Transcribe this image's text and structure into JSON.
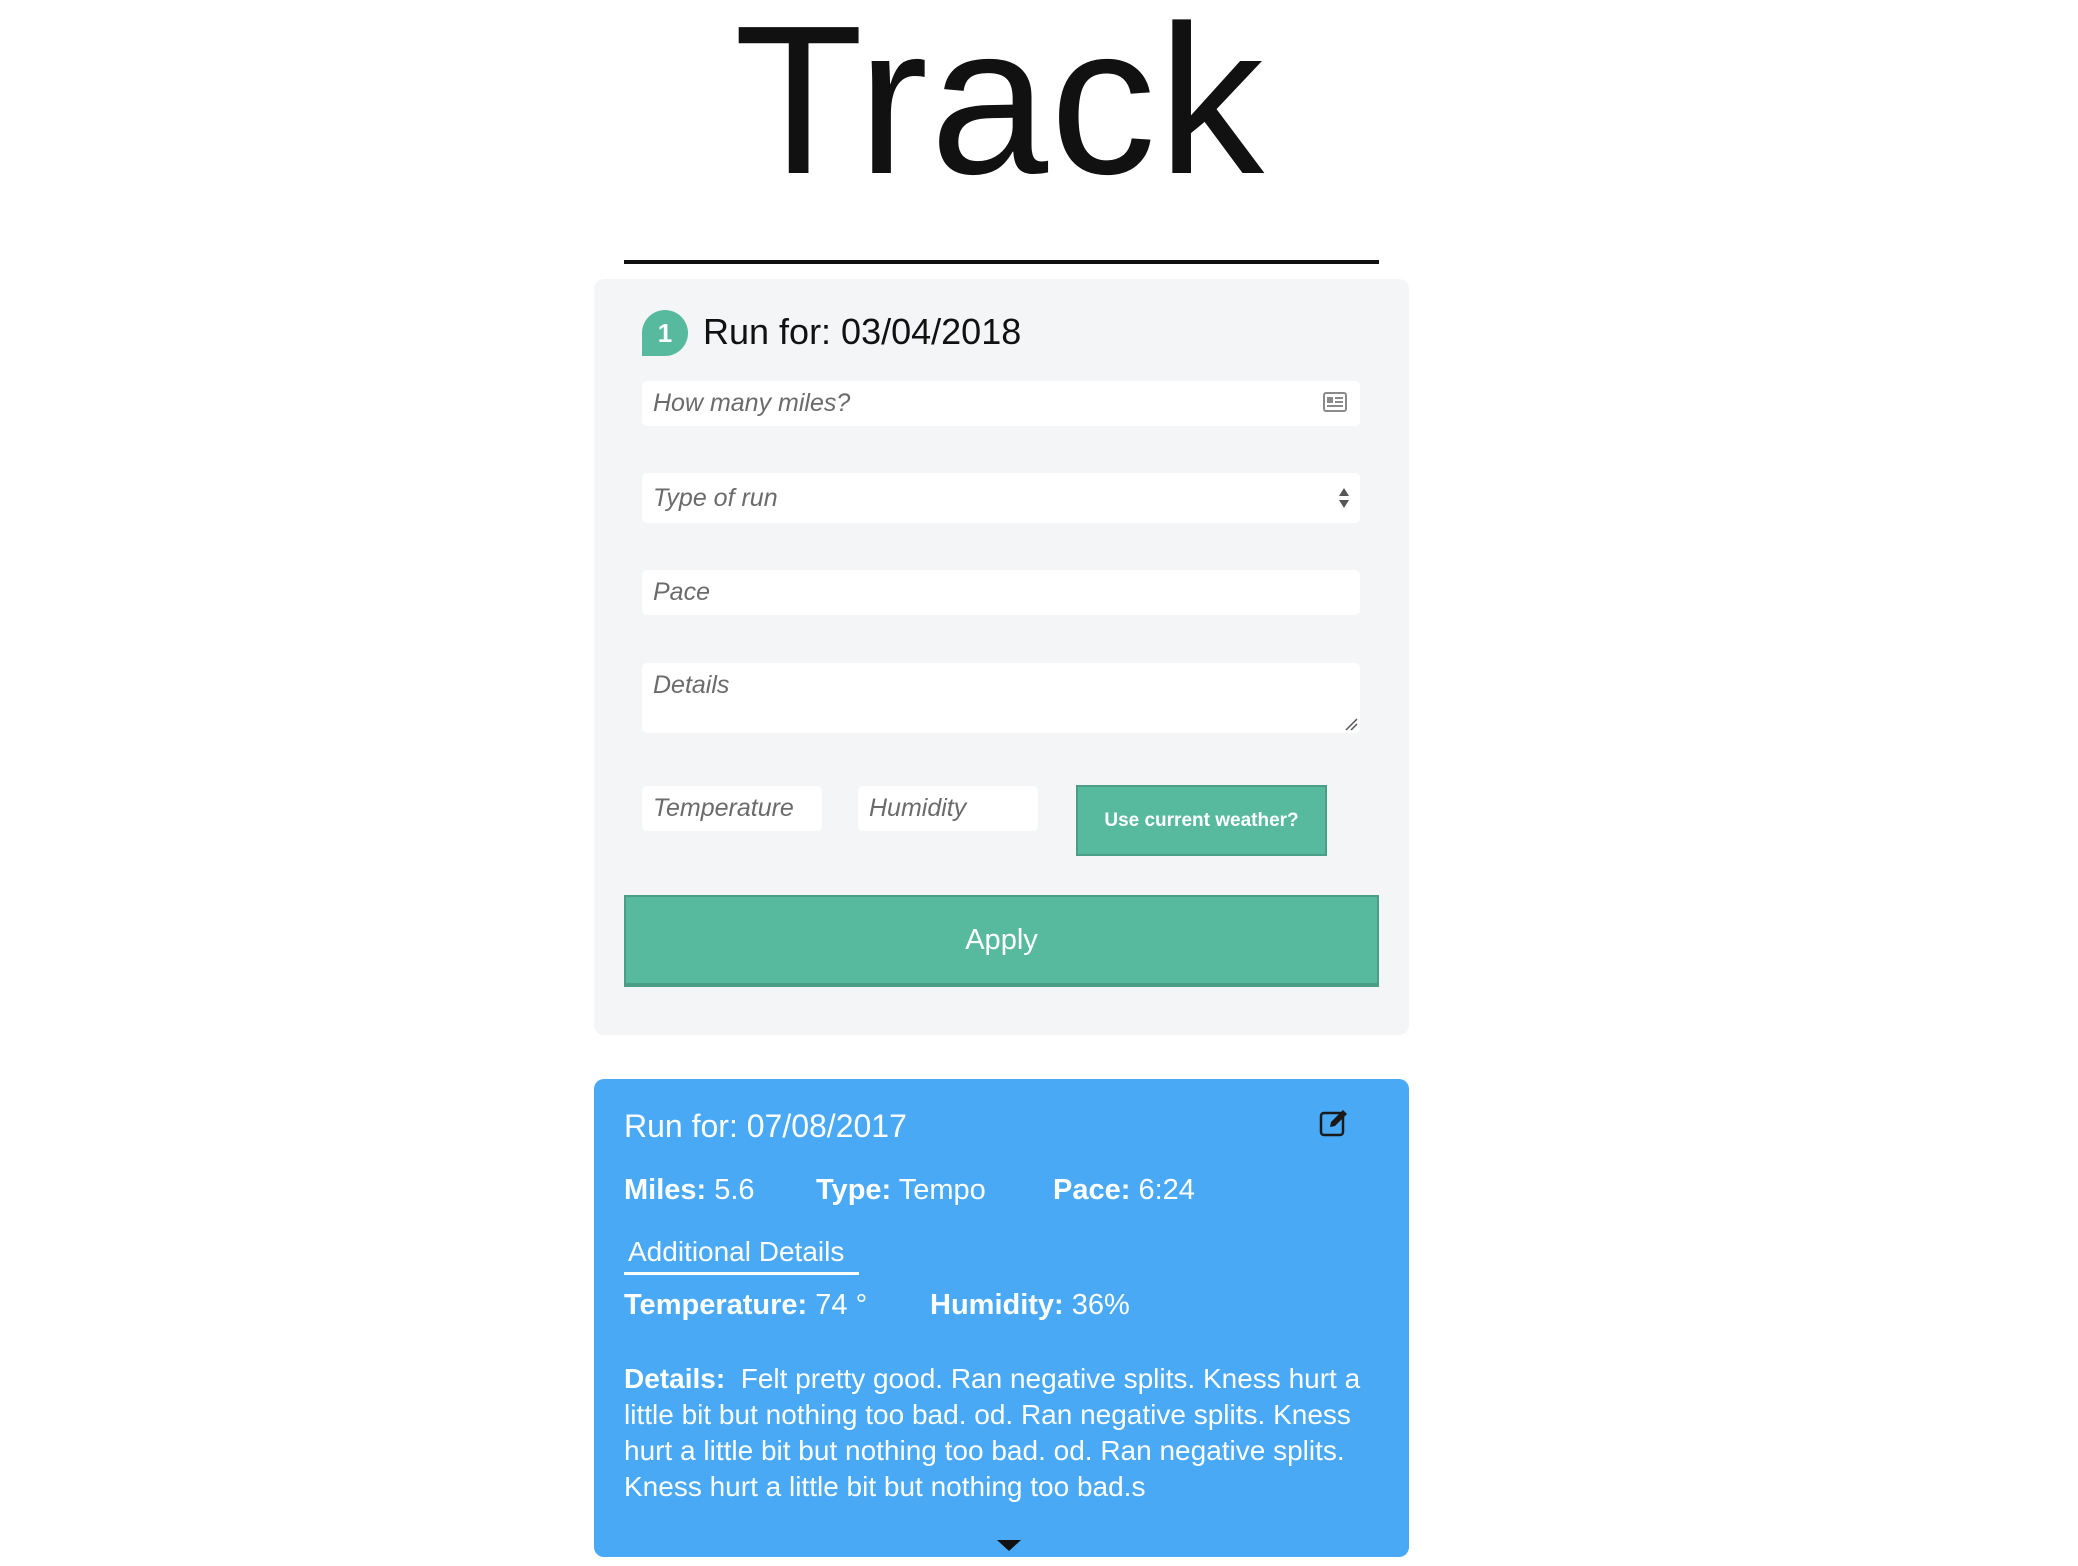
{
  "header": {
    "title": "Track"
  },
  "form": {
    "step_number": "1",
    "title": "Run for: 03/04/2018",
    "miles_placeholder": "How many miles?",
    "type_placeholder": "Type of run",
    "pace_placeholder": "Pace",
    "details_placeholder": "Details",
    "temperature_placeholder": "Temperature",
    "humidity_placeholder": "Humidity",
    "weather_button": "Use current weather?",
    "apply_button": "Apply",
    "icons": {
      "miles": "id-card-icon",
      "type": "select-arrows-icon"
    }
  },
  "run": {
    "title": "Run for: 07/08/2017",
    "miles_label": "Miles:",
    "miles_value": "5.6",
    "type_label": "Type:",
    "type_value": "Tempo",
    "pace_label": "Pace:",
    "pace_value": "6:24",
    "additional_details_link": "Additional Details",
    "temperature_label": "Temperature:",
    "temperature_value": "74 °",
    "humidity_label": "Humidity:",
    "humidity_value": "36%",
    "details_label": "Details:",
    "details_value": "Felt pretty good. Ran negative splits. Kness hurt a little bit but nothing too bad. od. Ran negative splits. Kness hurt a little bit but nothing too bad. od. Ran negative splits. Kness hurt a little bit but nothing too bad.s",
    "icons": {
      "edit": "edit-icon",
      "expand": "caret-down-icon"
    }
  },
  "colors": {
    "accent_green": "#57ba9e",
    "card_blue": "#49a9f5",
    "form_background": "#f4f5f6"
  }
}
